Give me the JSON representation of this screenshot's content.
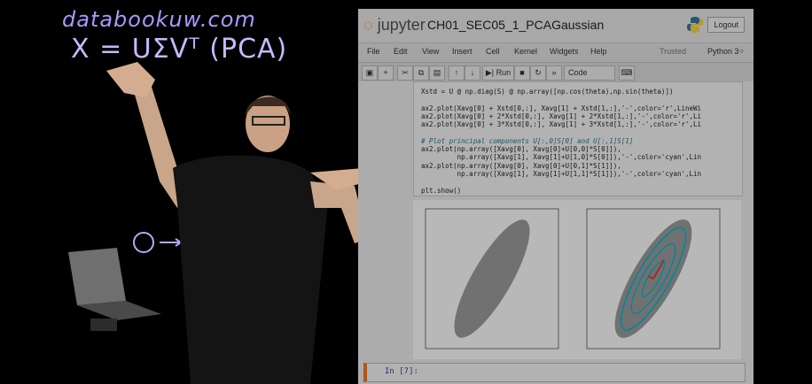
{
  "whiteboard": {
    "url": "databookuw.com",
    "formula": "X = UΣVᵀ (PCA)"
  },
  "notebook": {
    "logo_text": "jupyter",
    "title": "CH01_SEC05_1_PCAGaussian",
    "logout_label": "Logout",
    "menu": [
      "File",
      "Edit",
      "View",
      "Insert",
      "Cell",
      "Kernel",
      "Widgets",
      "Help"
    ],
    "trusted_label": "Trusted",
    "kernel_label": "Python 3",
    "toolbar": {
      "run_label": "Run",
      "cell_type": "Code"
    },
    "code_lines": [
      "Xstd = U @ np.diag(S) @ np.array([np.cos(theta),np.sin(theta)])",
      "",
      "ax2.plot(Xavg[0] + Xstd[0,:], Xavg[1] + Xstd[1,:],'-',color='r',LineWi",
      "ax2.plot(Xavg[0] + 2*Xstd[0,:], Xavg[1] + 2*Xstd[1,:],'-',color='r',Li",
      "ax2.plot(Xavg[0] + 3*Xstd[0,:], Xavg[1] + 3*Xstd[1,:],'-',color='r',Li",
      "",
      "# Plot principal components U[:,0]S[0] and U[:,1]S[1]",
      "ax2.plot(np.array([Xavg[0], Xavg[0]+U[0,0]*S[0]]),",
      "         np.array([Xavg[1], Xavg[1]+U[1,0]*S[0]]),'-',color='cyan',Lin",
      "ax2.plot(np.array([Xavg[0], Xavg[0]+U[0,1]*S[1]]),",
      "         np.array([Xavg[1], Xavg[1]+U[1,1]*S[1]]),'-',color='cyan',Lin",
      "",
      "plt.show()"
    ],
    "next_prompt": "In [7]:"
  },
  "colors": {
    "accent": "#f37726",
    "ellipse": "#00bcd4",
    "pc_red": "#e53935"
  }
}
